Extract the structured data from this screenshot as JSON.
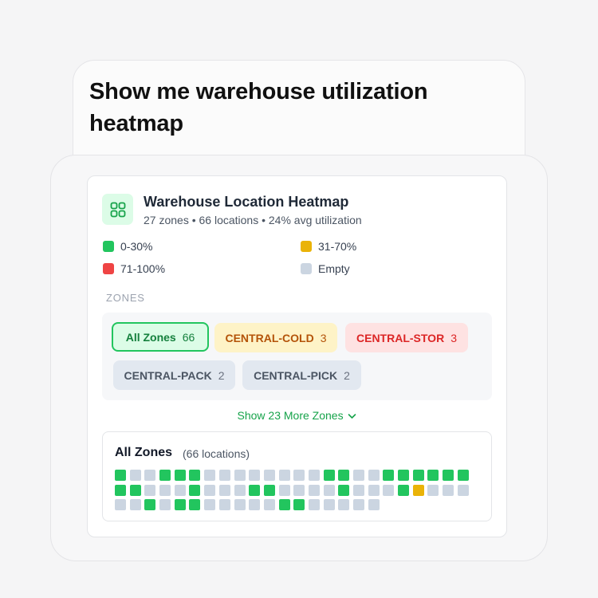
{
  "prompt": {
    "text": "Show me warehouse utilization heatmap"
  },
  "widget": {
    "icon": "grid-icon",
    "title": "Warehouse Location Heatmap",
    "subtitle": "27 zones • 66 locations • 24% avg utilization",
    "legend": [
      {
        "label": "0-30%",
        "color": "#22c55e"
      },
      {
        "label": "31-70%",
        "color": "#eab308"
      },
      {
        "label": "71-100%",
        "color": "#ef4444"
      },
      {
        "label": "Empty",
        "color": "#cbd5e1"
      }
    ],
    "zones_label": "ZONES",
    "zones": [
      {
        "name": "All Zones",
        "count": "66",
        "style": "active"
      },
      {
        "name": "CENTRAL-COLD",
        "count": "3",
        "style": "yellow"
      },
      {
        "name": "CENTRAL-STOR",
        "count": "3",
        "style": "red"
      },
      {
        "name": "CENTRAL-PACK",
        "count": "2",
        "style": "gray"
      },
      {
        "name": "CENTRAL-PICK",
        "count": "2",
        "style": "gray"
      }
    ],
    "more_zones_label": "Show 23 More Zones",
    "grid": {
      "title": "All Zones",
      "count_label": "(66 locations)",
      "status_colors": {
        "L": "#22c55e",
        "M": "#eab308",
        "H": "#ef4444",
        "E": "#cbd5e1"
      },
      "cells": [
        "L",
        "E",
        "E",
        "L",
        "L",
        "L",
        "E",
        "E",
        "E",
        "E",
        "E",
        "E",
        "E",
        "E",
        "L",
        "L",
        "E",
        "E",
        "L",
        "L",
        "L",
        "L",
        "L",
        "L",
        "L",
        "L",
        "E",
        "E",
        "E",
        "L",
        "E",
        "E",
        "E",
        "L",
        "L",
        "E",
        "E",
        "E",
        "E",
        "L",
        "E",
        "E",
        "E",
        "L",
        "M",
        "E",
        "E",
        "E",
        "E",
        "E",
        "L",
        "E",
        "L",
        "L",
        "E",
        "E",
        "E",
        "E",
        "E",
        "L",
        "L",
        "E",
        "E",
        "E",
        "E",
        "E"
      ]
    }
  }
}
